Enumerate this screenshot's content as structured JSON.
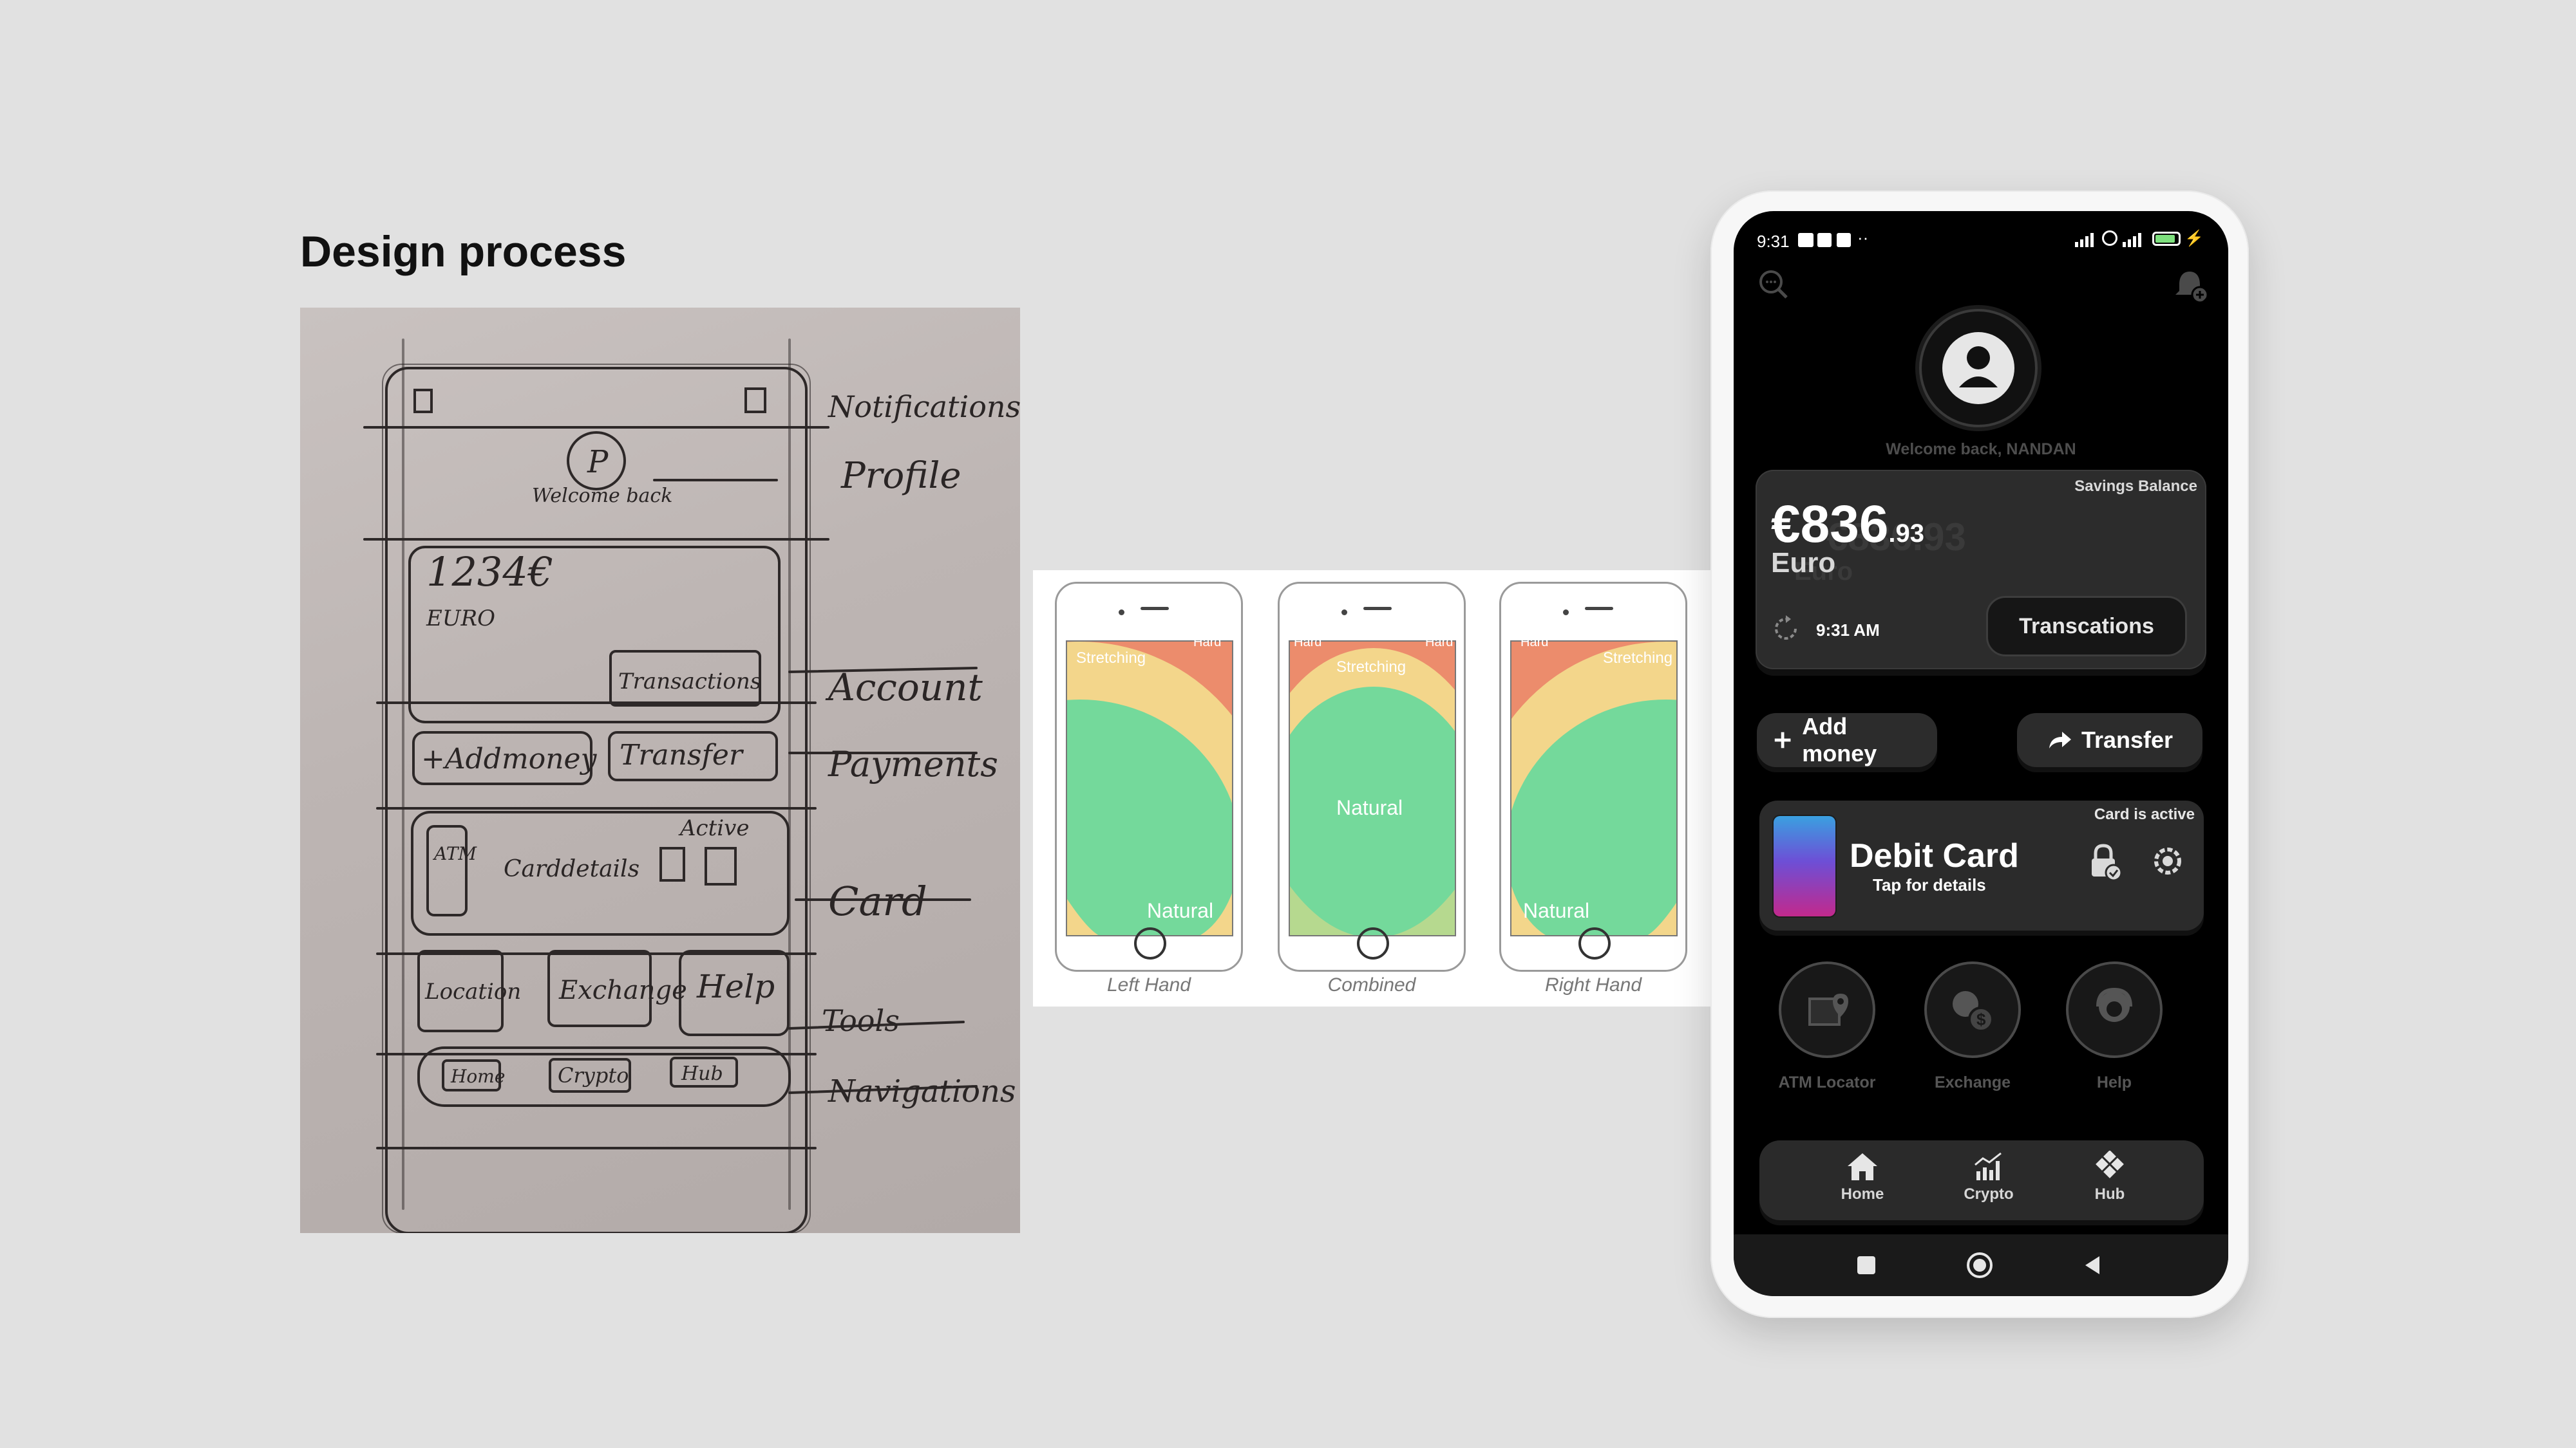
{
  "page": {
    "heading": "Design process"
  },
  "sketch": {
    "notes": [
      "Notifications",
      "Profile",
      "Account",
      "Payments",
      "Card",
      "Tools",
      "Navigations"
    ],
    "inside": {
      "profile_letter": "P",
      "welcome": "Welcome back",
      "amount": "1234€",
      "currency": "EURO",
      "transactions": "Transactions",
      "add_money": "+Addmoney",
      "transfer": "Transfer",
      "active": "Active",
      "atm": "ATM",
      "card_details": "Carddetails",
      "location": "Location",
      "exchange": "Exchange",
      "help": "Help",
      "home": "Home",
      "crypto": "Crypto",
      "hub": "Hub"
    }
  },
  "thumb_zones": {
    "phones": [
      {
        "caption": "Left Hand",
        "labels": {
          "stretch": "Stretching",
          "hard": "Hard",
          "natural": "Natural"
        }
      },
      {
        "caption": "Combined",
        "labels": {
          "hard_left": "Hard",
          "hard_right": "Hard",
          "stretch": "Stretching",
          "natural": "Natural"
        }
      },
      {
        "caption": "Right Hand",
        "labels": {
          "hard": "Hard",
          "stretch": "Stretching",
          "natural": "Natural"
        }
      }
    ],
    "colors": {
      "hard": "#ec8c6c",
      "stretch": "#f3d68b",
      "natural": "#74d99b"
    }
  },
  "app": {
    "status_time": "9:31",
    "welcome": "Welcome back, NANDAN",
    "savings_label": "Savings Balance",
    "amount_main": "€836",
    "amount_cents": ".93",
    "currency": "Euro",
    "updated_time": "9:31 AM",
    "transactions_button": "Transcations",
    "add_money": "Add money",
    "transfer": "Transfer",
    "card_status": "Card is active",
    "card_title": "Debit Card",
    "card_subtitle": "Tap for details",
    "tools": [
      {
        "label": "ATM Locator",
        "icon": "map-pin-icon"
      },
      {
        "label": "Exchange",
        "icon": "currency-exchange-icon"
      },
      {
        "label": "Help",
        "icon": "support-agent-icon"
      }
    ],
    "nav": [
      {
        "label": "Home",
        "icon": "home-icon"
      },
      {
        "label": "Crypto",
        "icon": "chart-icon"
      },
      {
        "label": "Hub",
        "icon": "grid-diamond-icon"
      }
    ]
  }
}
